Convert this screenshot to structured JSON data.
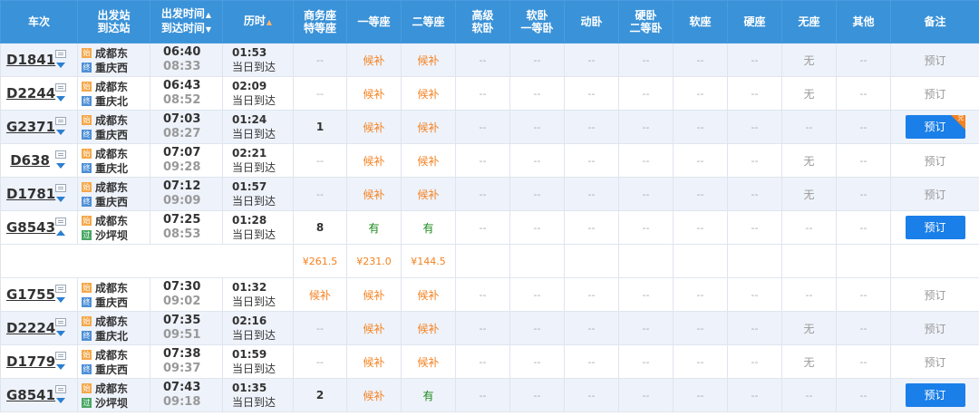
{
  "headers": {
    "train": "车次",
    "station_a": "出发站",
    "station_b": "到达站",
    "time_a": "出发时间",
    "time_b": "到达时间",
    "duration": "历时",
    "biz_a": "商务座",
    "biz_b": "特等座",
    "first": "一等座",
    "second": "二等座",
    "hsoft_a": "高级",
    "hsoft_b": "软卧",
    "soft1_a": "软卧",
    "soft1_b": "一等卧",
    "dong": "动卧",
    "hard2_a": "硬卧",
    "hard2_b": "二等卧",
    "softseat": "软座",
    "hardseat": "硬座",
    "noseat": "无座",
    "other": "其他",
    "remark": "备注"
  },
  "icons": {
    "sort_up": "▲",
    "sort_down": "▼",
    "start_badge": "始",
    "end_badge": "终",
    "pass_badge": "过"
  },
  "rows": [
    {
      "train": "D1841",
      "from": "成都东",
      "to": "重庆西",
      "dep": "06:40",
      "arr": "08:33",
      "dur": "01:53",
      "day": "当日到达",
      "biz": "--",
      "first": "候补",
      "second": "候补",
      "hs": "--",
      "s1": "--",
      "dong": "--",
      "h2": "--",
      "ss": "--",
      "hseat": "--",
      "noseat": "无",
      "other": "--",
      "action": "预订",
      "bookable": false,
      "endType": "end",
      "arrow": "down"
    },
    {
      "train": "D2244",
      "from": "成都东",
      "to": "重庆北",
      "dep": "06:43",
      "arr": "08:52",
      "dur": "02:09",
      "day": "当日到达",
      "biz": "--",
      "first": "候补",
      "second": "候补",
      "hs": "--",
      "s1": "--",
      "dong": "--",
      "h2": "--",
      "ss": "--",
      "hseat": "--",
      "noseat": "无",
      "other": "--",
      "action": "预订",
      "bookable": false,
      "endType": "end",
      "arrow": "down"
    },
    {
      "train": "G2371",
      "from": "成都东",
      "to": "重庆西",
      "dep": "07:03",
      "arr": "08:27",
      "dur": "01:24",
      "day": "当日到达",
      "biz": "1",
      "first": "候补",
      "second": "候补",
      "hs": "--",
      "s1": "--",
      "dong": "--",
      "h2": "--",
      "ss": "--",
      "hseat": "--",
      "noseat": "--",
      "other": "--",
      "action": "预订",
      "bookable": true,
      "tag": "兑",
      "endType": "end",
      "arrow": "down"
    },
    {
      "train": "D638",
      "from": "成都东",
      "to": "重庆北",
      "dep": "07:07",
      "arr": "09:28",
      "dur": "02:21",
      "day": "当日到达",
      "biz": "--",
      "first": "候补",
      "second": "候补",
      "hs": "--",
      "s1": "--",
      "dong": "--",
      "h2": "--",
      "ss": "--",
      "hseat": "--",
      "noseat": "无",
      "other": "--",
      "action": "预订",
      "bookable": false,
      "endType": "end",
      "arrow": "down"
    },
    {
      "train": "D1781",
      "from": "成都东",
      "to": "重庆西",
      "dep": "07:12",
      "arr": "09:09",
      "dur": "01:57",
      "day": "当日到达",
      "biz": "--",
      "first": "候补",
      "second": "候补",
      "hs": "--",
      "s1": "--",
      "dong": "--",
      "h2": "--",
      "ss": "--",
      "hseat": "--",
      "noseat": "无",
      "other": "--",
      "action": "预订",
      "bookable": false,
      "endType": "end",
      "arrow": "down"
    },
    {
      "train": "G8543",
      "from": "成都东",
      "to": "沙坪坝",
      "dep": "07:25",
      "arr": "08:53",
      "dur": "01:28",
      "day": "当日到达",
      "biz": "8",
      "first": "有",
      "second": "有",
      "hs": "--",
      "s1": "--",
      "dong": "--",
      "h2": "--",
      "ss": "--",
      "hseat": "--",
      "noseat": "--",
      "other": "--",
      "action": "预订",
      "bookable": true,
      "endType": "pass",
      "arrow": "up"
    },
    {
      "train": "G1755",
      "from": "成都东",
      "to": "重庆西",
      "dep": "07:30",
      "arr": "09:02",
      "dur": "01:32",
      "day": "当日到达",
      "biz": "候补",
      "first": "候补",
      "second": "候补",
      "hs": "--",
      "s1": "--",
      "dong": "--",
      "h2": "--",
      "ss": "--",
      "hseat": "--",
      "noseat": "--",
      "other": "--",
      "action": "预订",
      "bookable": false,
      "endType": "end",
      "arrow": "down"
    },
    {
      "train": "D2224",
      "from": "成都东",
      "to": "重庆北",
      "dep": "07:35",
      "arr": "09:51",
      "dur": "02:16",
      "day": "当日到达",
      "biz": "--",
      "first": "候补",
      "second": "候补",
      "hs": "--",
      "s1": "--",
      "dong": "--",
      "h2": "--",
      "ss": "--",
      "hseat": "--",
      "noseat": "无",
      "other": "--",
      "action": "预订",
      "bookable": false,
      "endType": "end",
      "arrow": "down"
    },
    {
      "train": "D1779",
      "from": "成都东",
      "to": "重庆西",
      "dep": "07:38",
      "arr": "09:37",
      "dur": "01:59",
      "day": "当日到达",
      "biz": "--",
      "first": "候补",
      "second": "候补",
      "hs": "--",
      "s1": "--",
      "dong": "--",
      "h2": "--",
      "ss": "--",
      "hseat": "--",
      "noseat": "无",
      "other": "--",
      "action": "预订",
      "bookable": false,
      "endType": "end",
      "arrow": "down"
    },
    {
      "train": "G8541",
      "from": "成都东",
      "to": "沙坪坝",
      "dep": "07:43",
      "arr": "09:18",
      "dur": "01:35",
      "day": "当日到达",
      "biz": "2",
      "first": "候补",
      "second": "有",
      "hs": "--",
      "s1": "--",
      "dong": "--",
      "h2": "--",
      "ss": "--",
      "hseat": "--",
      "noseat": "--",
      "other": "--",
      "action": "预订",
      "bookable": true,
      "endType": "pass",
      "arrow": "down"
    }
  ],
  "price_row": {
    "after_index": 5,
    "biz": "¥261.5",
    "first": "¥231.0",
    "second": "¥144.5"
  }
}
